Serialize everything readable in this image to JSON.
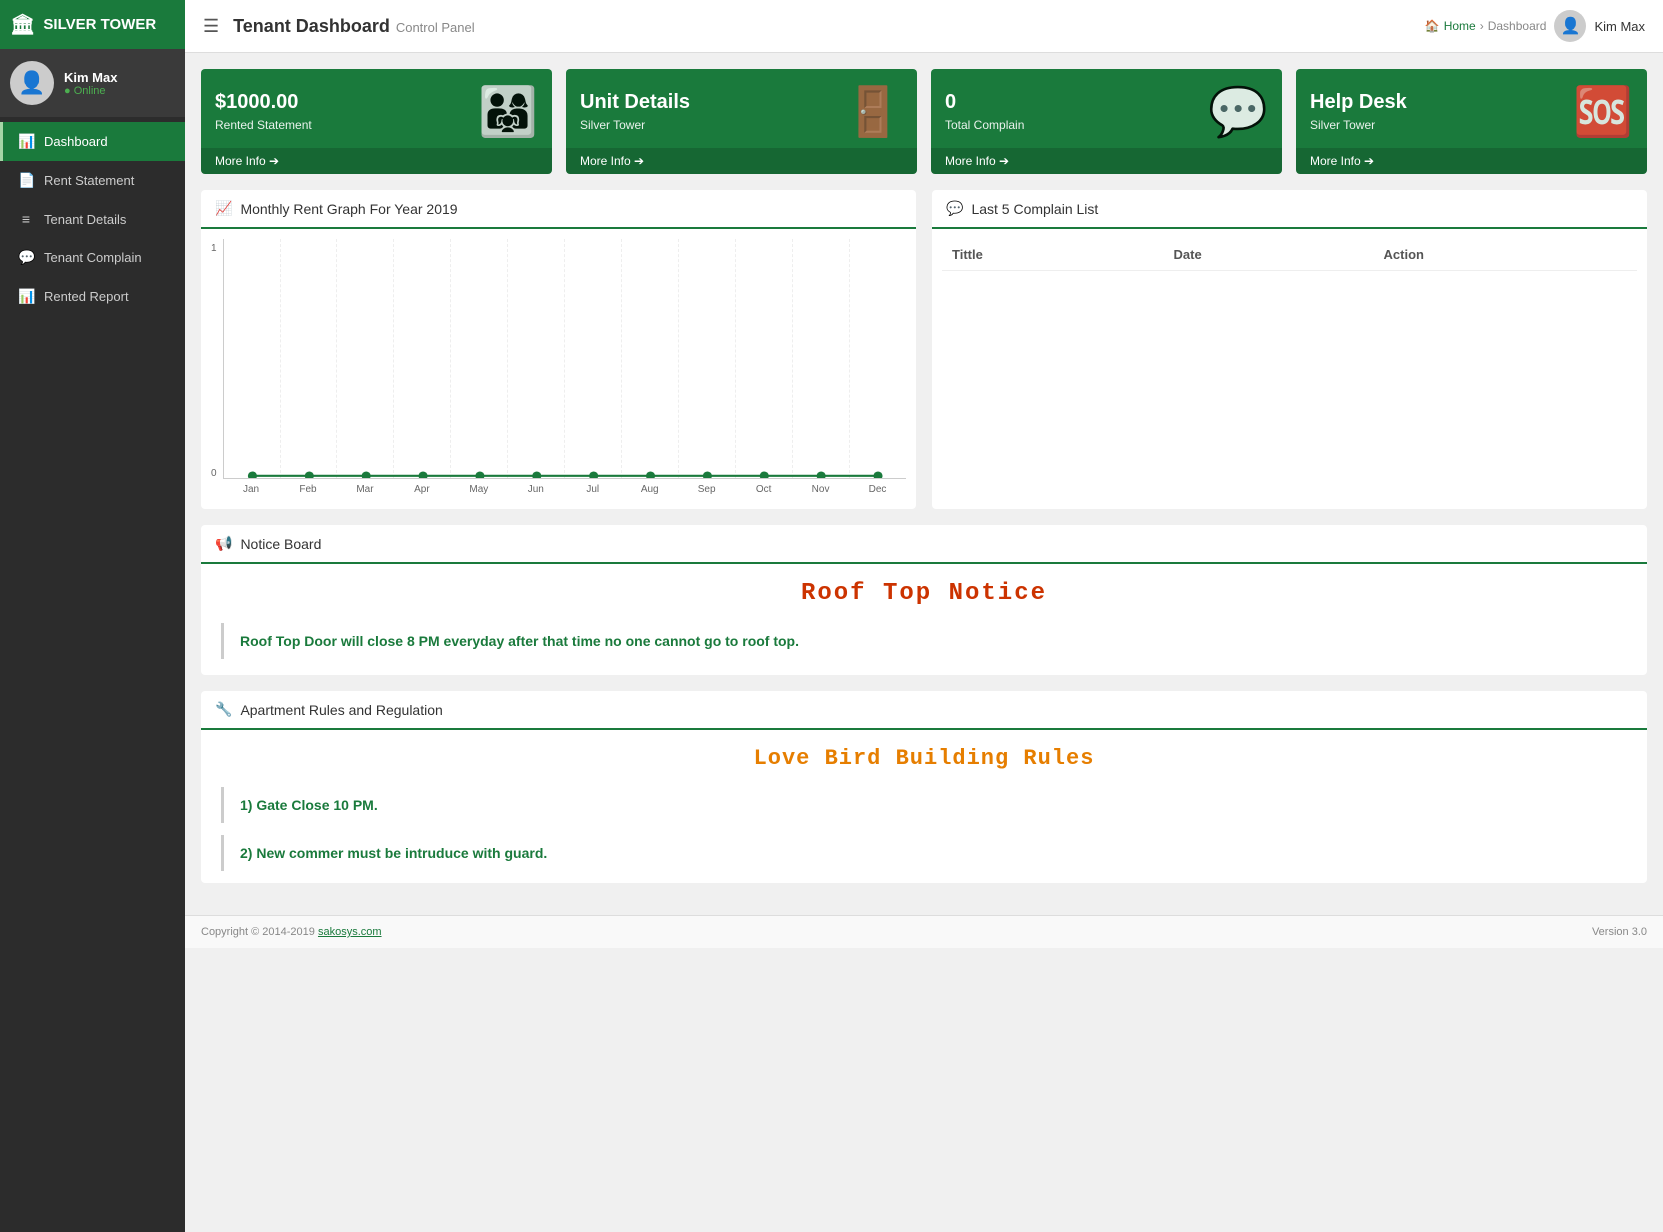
{
  "app": {
    "name": "SILVER TOWER",
    "building_icon": "🏛"
  },
  "topbar": {
    "menu_icon": "☰",
    "page_title": "Tenant Dashboard",
    "page_subtitle": "Control Panel",
    "breadcrumb_home": "Home",
    "breadcrumb_current": "Dashboard",
    "user_name": "Kim Max"
  },
  "sidebar": {
    "profile": {
      "name": "Kim Max",
      "status": "Online"
    },
    "items": [
      {
        "id": "dashboard",
        "label": "Dashboard",
        "icon": "📊",
        "active": true
      },
      {
        "id": "rent-statement",
        "label": "Rent Statement",
        "icon": "📄",
        "active": false
      },
      {
        "id": "tenant-details",
        "label": "Tenant Details",
        "icon": "≡",
        "active": false
      },
      {
        "id": "tenant-complain",
        "label": "Tenant Complain",
        "icon": "💬",
        "active": false
      },
      {
        "id": "rented-report",
        "label": "Rented Report",
        "icon": "📊",
        "active": false
      }
    ]
  },
  "stats": [
    {
      "id": "rented-statement",
      "value": "$1000.00",
      "label": "Rented Statement",
      "icon": "👨‍👩‍👧",
      "footer": "More Info ➔"
    },
    {
      "id": "unit-details",
      "value": "Unit Details",
      "label": "Silver Tower",
      "icon": "🚪",
      "footer": "More Info ➔"
    },
    {
      "id": "total-complain",
      "value": "0",
      "label": "Total Complain",
      "icon": "💬",
      "footer": "More Info ➔"
    },
    {
      "id": "help-desk",
      "value": "Help Desk",
      "label": "Silver Tower",
      "icon": "🆘",
      "footer": "More Info ➔"
    }
  ],
  "chart": {
    "title": "Monthly Rent Graph For Year 2019",
    "title_icon": "📈",
    "y_max": "1",
    "y_min": "0",
    "months": [
      "Jan",
      "Feb",
      "Mar",
      "Apr",
      "May",
      "Jun",
      "Jul",
      "Aug",
      "Sep",
      "Oct",
      "Nov",
      "Dec"
    ],
    "values": [
      0,
      0,
      0,
      0,
      0,
      0,
      0,
      0,
      0,
      0,
      0,
      0
    ]
  },
  "complain_list": {
    "title": "Last 5 Complain List",
    "title_icon": "💬",
    "columns": [
      "Tittle",
      "Date",
      "Action"
    ],
    "rows": []
  },
  "notice_board": {
    "title": "Notice Board",
    "title_icon": "📢",
    "notice_title": "Roof Top Notice",
    "notice_content": "Roof Top Door will close 8 PM everyday after that time no one cannot go to roof top."
  },
  "rules": {
    "title": "Apartment Rules and Regulation",
    "title_icon": "🔧",
    "rules_title": "Love Bird Building Rules",
    "items": [
      "1) Gate Close 10 PM.",
      "2) New commer must be intruduce with guard."
    ]
  },
  "footer": {
    "copyright": "Copyright © 2014-2019 ",
    "link_text": "sakosys.com",
    "version": "Version 3.0"
  }
}
